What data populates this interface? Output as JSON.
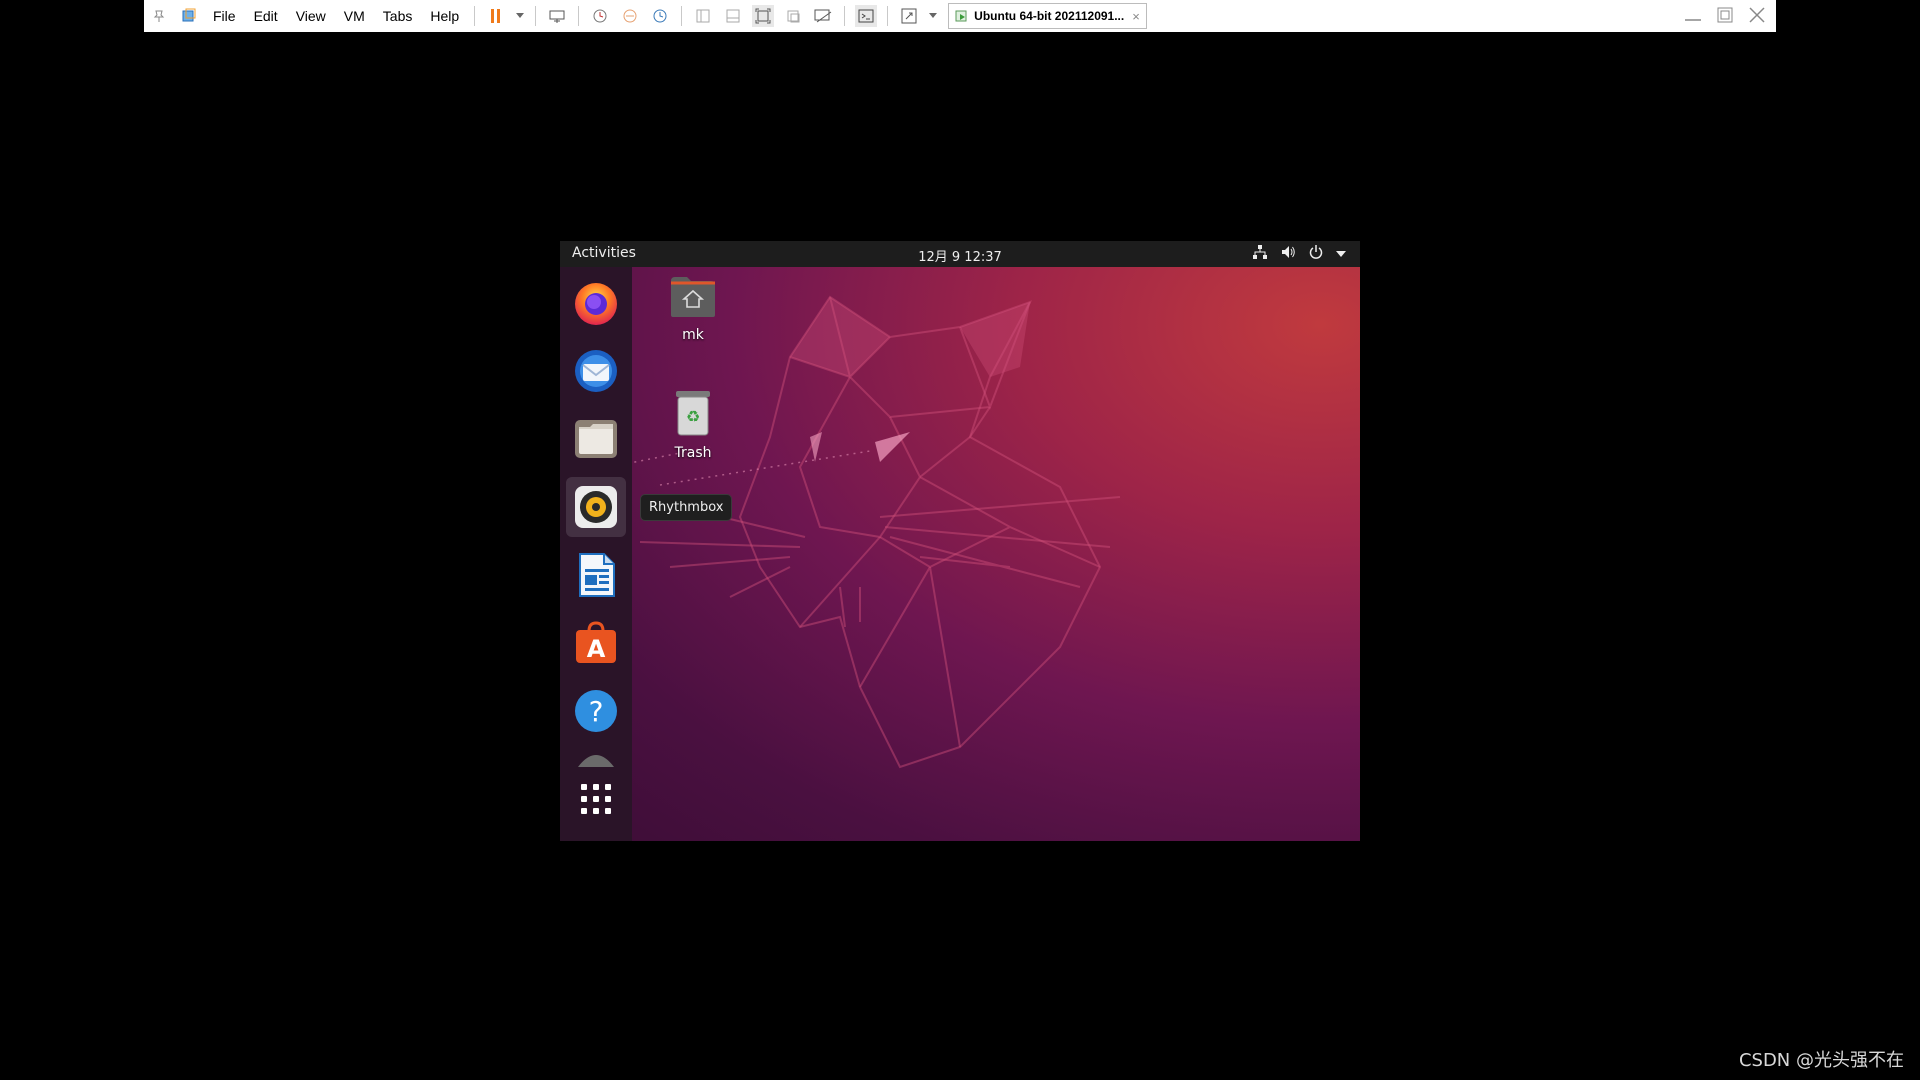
{
  "host": {
    "menu": [
      "File",
      "Edit",
      "View",
      "VM",
      "Tabs",
      "Help"
    ],
    "tab_title": "Ubuntu 64-bit 202112091...",
    "tab_close": "×"
  },
  "vm": {
    "topbar": {
      "activities": "Activities",
      "clock": "12月 9  12:37"
    },
    "dock": {
      "items": [
        "firefox",
        "thunderbird",
        "files",
        "rhythmbox",
        "libreoffice-writer",
        "ubuntu-software",
        "help",
        "show-applications"
      ],
      "tooltip": "Rhythmbox"
    },
    "desktop": {
      "icons": [
        {
          "label": "mk"
        },
        {
          "label": "Trash"
        }
      ]
    }
  },
  "watermark": "CSDN @光头强不在"
}
